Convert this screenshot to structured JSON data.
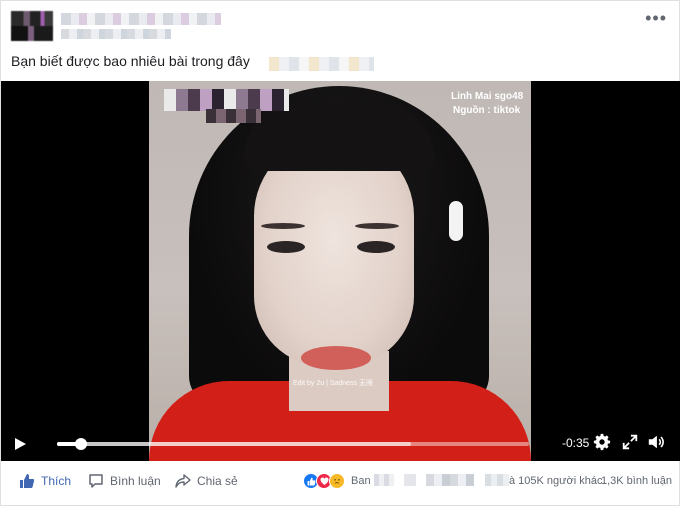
{
  "post": {
    "more_glyph": "•••",
    "caption": "Bạn biết được bao nhiêu bài trong đây"
  },
  "video": {
    "watermark_name": "Linh Mai sgo48",
    "watermark_source": "Nguồn : tiktok",
    "edit_credit": "Edit by 2u | Sadness 无限",
    "time_remaining": "-0:35",
    "progress_fraction": 0.05,
    "buffered_fraction": 0.75
  },
  "actions": {
    "like_label": "Thích",
    "comment_label": "Bình luận",
    "share_label": "Chia sẻ"
  },
  "stats": {
    "friends_prefix": "Ban",
    "others_text": "à 105K người khác",
    "separator": "·",
    "comments_text": "1,3K bình luận",
    "reactions": [
      "like",
      "love",
      "sad"
    ]
  },
  "colors": {
    "accent": "#4267b2",
    "like_reaction": "#1877f2",
    "love_reaction": "#f02849",
    "sad_reaction": "#f7b928"
  }
}
